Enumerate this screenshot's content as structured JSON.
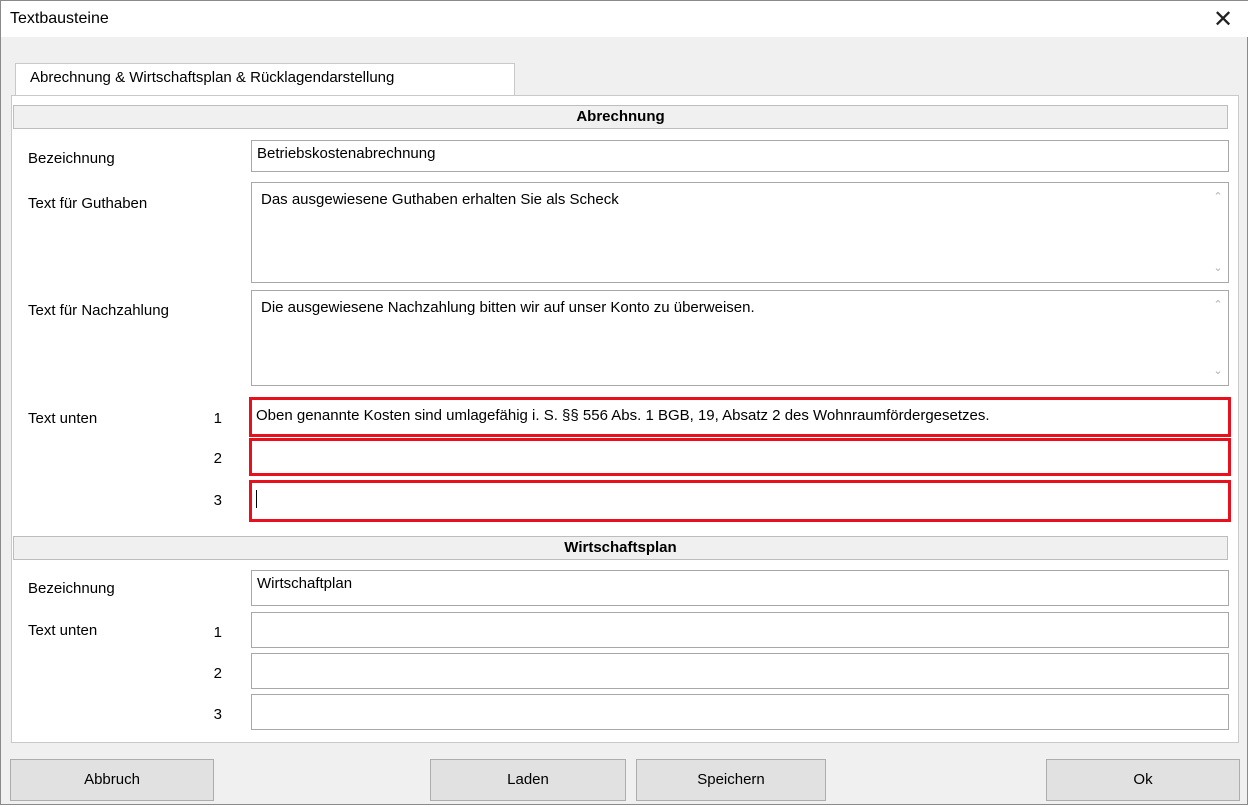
{
  "window": {
    "title": "Textbausteine",
    "close_icon": "close-icon"
  },
  "tabs": [
    {
      "label": "Abrechnung & Wirtschaftsplan & Rücklagendarstellung"
    }
  ],
  "abrechnung": {
    "header": "Abrechnung",
    "bezeichnung_label": "Bezeichnung",
    "bezeichnung_value": "Betriebskostenabrechnung",
    "guthaben_label": "Text für Guthaben",
    "guthaben_value": "Das ausgewiesene Guthaben erhalten Sie als Scheck",
    "nachzahlung_label": "Text für Nachzahlung",
    "nachzahlung_value": "Die ausgewiesene Nachzahlung bitten wir auf unser Konto zu überweisen.",
    "text_unten_label": "Text unten",
    "text_unten": [
      {
        "num": "1",
        "value": "Oben genannte Kosten sind umlagefähig i. S. §§ 556 Abs. 1 BGB, 19, Absatz 2 des Wohnraumfördergesetzes."
      },
      {
        "num": "2",
        "value": ""
      },
      {
        "num": "3",
        "value": ""
      }
    ]
  },
  "wirtschaftsplan": {
    "header": "Wirtschaftsplan",
    "bezeichnung_label": "Bezeichnung",
    "bezeichnung_value": "Wirtschaftplan",
    "text_unten_label": "Text unten",
    "text_unten": [
      {
        "num": "1",
        "value": ""
      },
      {
        "num": "2",
        "value": ""
      },
      {
        "num": "3",
        "value": ""
      }
    ]
  },
  "buttons": {
    "abbruch": "Abbruch",
    "laden": "Laden",
    "speichern": "Speichern",
    "ok": "Ok"
  },
  "colors": {
    "highlight": "#e8101c",
    "dialog_bg": "#f0f0f0"
  }
}
